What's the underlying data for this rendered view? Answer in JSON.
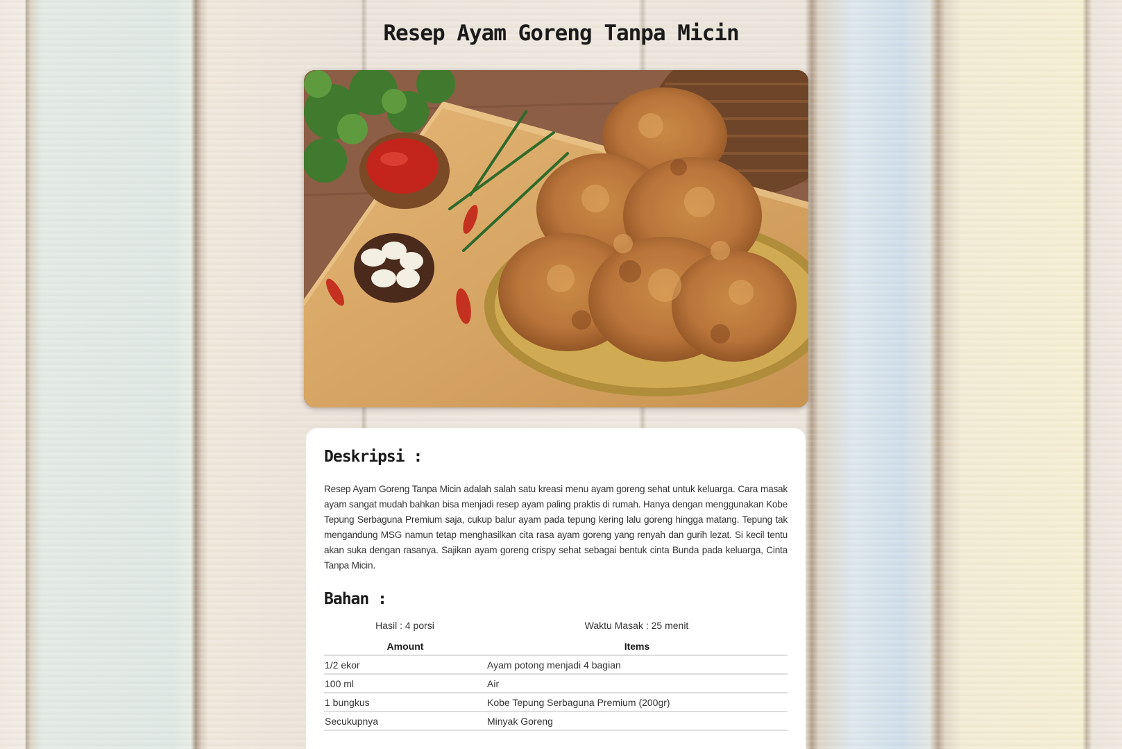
{
  "page": {
    "title": "Resep Ayam Goreng Tanpa Micin"
  },
  "hero": {
    "icon": "fried-chicken-photo"
  },
  "description": {
    "heading": "Deskripsi :",
    "text": "Resep Ayam Goreng Tanpa Micin adalah salah satu kreasi menu ayam goreng sehat untuk keluarga. Cara masak ayam sangat mudah bahkan bisa menjadi resep ayam paling praktis di rumah. Hanya dengan menggunakan Kobe Tepung Serbaguna Premium saja, cukup balur ayam pada tepung kering lalu goreng hingga matang. Tepung tak mengandung MSG namun tetap menghasilkan cita rasa ayam goreng yang renyah dan gurih lezat. Si kecil tentu akan suka dengan rasanya. Sajikan ayam goreng crispy sehat sebagai bentuk cinta Bunda pada keluarga, Cinta Tanpa Micin."
  },
  "ingredients": {
    "heading": "Bahan :",
    "yield": "Hasil : 4 porsi",
    "cook_time": "Waktu Masak : 25 menit",
    "headers": {
      "amount": "Amount",
      "items": "Items"
    },
    "rows": [
      {
        "amount": "1/2 ekor",
        "item": "Ayam potong menjadi 4 bagian"
      },
      {
        "amount": "100 ml",
        "item": "Air"
      },
      {
        "amount": "1 bungkus",
        "item": "Kobe Tepung Serbaguna Premium (200gr)"
      },
      {
        "amount": "Secukupnya",
        "item": "Minyak Goreng"
      }
    ]
  }
}
